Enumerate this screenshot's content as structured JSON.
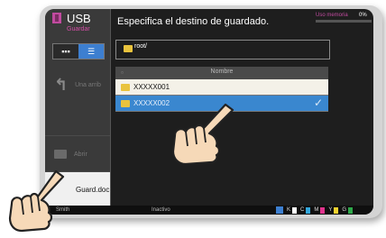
{
  "sidebar": {
    "title": "USB",
    "subtitle": "Guardar",
    "view_grid": "▪▪▪",
    "view_list": "☰",
    "up_label": "Una arrib",
    "open_label": "Abrir",
    "save_label": "Guard.doc"
  },
  "main": {
    "prompt": "Especifica el destino de guardado.",
    "memory_label": "Uso memoria",
    "memory_value": "0%",
    "memory_fraction": 0,
    "path": "root/",
    "table_header": "Nombre",
    "rows": [
      {
        "name": "XXXXX001",
        "selected": false
      },
      {
        "name": "XXXXX002",
        "selected": true
      }
    ]
  },
  "status": {
    "user": "Smith",
    "state": "Inactivo",
    "toner_labels": [
      "K",
      "C",
      "M",
      "Y",
      "G"
    ]
  },
  "colors": {
    "accent": "#3a87cf",
    "brand": "#c14a9f",
    "folder": "#e9c33d"
  },
  "icons": [
    "usb-icon",
    "folder-icon",
    "up-arrow-icon",
    "check-icon",
    "pointing-hand-icon"
  ]
}
